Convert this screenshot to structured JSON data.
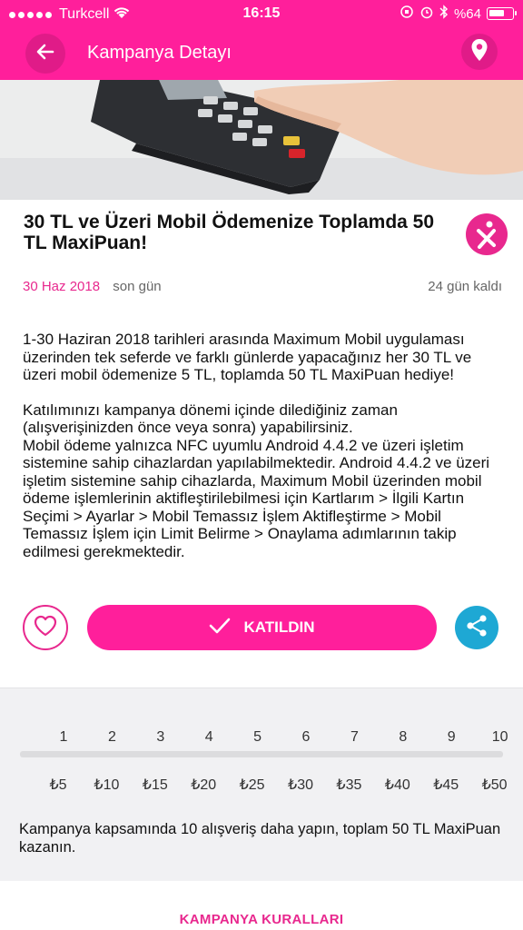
{
  "status_bar": {
    "carrier": "Turkcell",
    "time": "16:15",
    "battery_pct": "%64"
  },
  "header": {
    "title": "Kampanya Detayı",
    "back_icon": "arrow-left-icon",
    "location_icon": "location-pin-icon"
  },
  "campaign": {
    "title": "30 TL ve Üzeri Mobil Ödemenize Toplamda 50 TL MaxiPuan!",
    "end_date": "30 Haz 2018",
    "end_label": "son gün",
    "days_left": "24 gün kaldı",
    "description": [
      "1-30 Haziran 2018 tarihleri arasında Maximum Mobil uygulaması üzerinden tek seferde ve farklı günlerde yapacağınız her 30 TL ve üzeri mobil ödemenize 5 TL, toplamda 50 TL MaxiPuan hediye!",
      "Katılımınızı kampanya dönemi içinde dilediğiniz zaman (alışverişinizden önce veya sonra) yapabilirsiniz.\nMobil ödeme yalnızca NFC uyumlu Android 4.4.2 ve üzeri işletim sistemine sahip cihazlardan yapılabilmektedir. Android 4.4.2 ve üzeri işletim sistemine sahip cihazlarda, Maximum Mobil üzerinden mobil ödeme işlemlerinin aktifleştirilebilmesi için Kartlarım > İlgili Kartın Seçimi > Ayarlar > Mobil Temassız İşlem Aktifleştirme > Mobil Temassız İşlem için Limit Belirme > Onaylama adımlarının takip edilmesi gerekmektedir."
    ]
  },
  "actions": {
    "join_label": "KATILDIN",
    "like_icon": "heart-icon",
    "share_icon": "share-icon"
  },
  "progress": {
    "steps": [
      "1",
      "2",
      "3",
      "4",
      "5",
      "6",
      "7",
      "8",
      "9",
      "10"
    ],
    "amounts": [
      "₺5",
      "₺10",
      "₺15",
      "₺20",
      "₺25",
      "₺30",
      "₺35",
      "₺40",
      "₺45",
      "₺50"
    ],
    "completed": 0,
    "message": "Kampanya kapsamında 10 alışveriş daha yapın, toplam 50 TL MaxiPuan kazanın."
  },
  "footer": {
    "rules_label": "KAMPANYA KURALLARI"
  },
  "colors": {
    "brand": "#ff1f9b",
    "accent": "#e8288e",
    "share": "#1ea8d4"
  }
}
